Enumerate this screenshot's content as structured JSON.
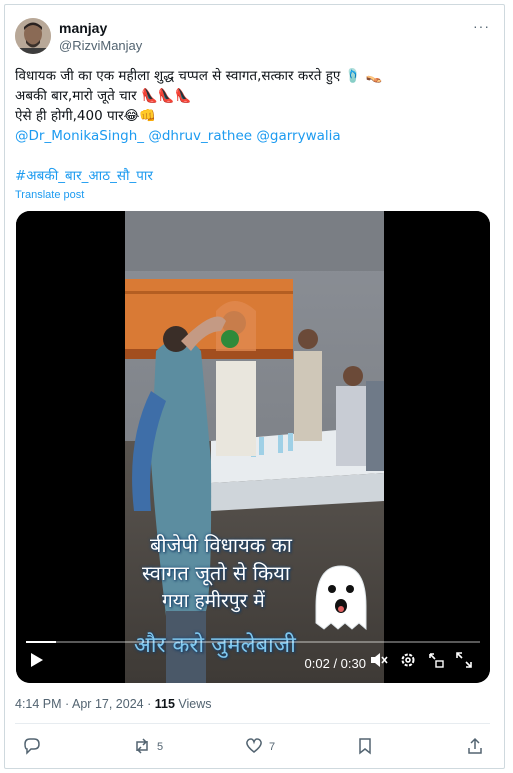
{
  "author": {
    "display_name": "manjay",
    "handle": "@RizviManjay",
    "more_label": "···"
  },
  "post": {
    "line1": "विधायक जी का एक महीला शुद्ध चप्पल से स्वागत,सत्कार करते हुए",
    "line2": "अबकी बार,मारो जूते चार",
    "line3": "ऐसे ही होगी,400 पार",
    "line1_emojis": "🩴 👡",
    "line2_emojis": "👠👠👠",
    "line3_emojis": "😂👊",
    "mentions": [
      "@Dr_MonikaSingh_",
      "@dhruv_rathee",
      "@garrywalia"
    ],
    "hashtag": "#अबकी_बार_आठ_सौ_पार",
    "translate": "Translate post"
  },
  "video": {
    "caption_line1": "बीजेपी विधायक का",
    "caption_line2": "स्वागत जूतो से किया",
    "caption_line3": "गया हमीरपुर में",
    "caption_line4": "और करो जुमलेबाजी",
    "ghost_emoji": "👻",
    "time": "0:02 / 0:30",
    "progress": 0.067
  },
  "meta": {
    "time": "4:14 PM",
    "separator": "·",
    "date": "Apr 17, 2024",
    "views_count": "115",
    "views_label": "Views"
  },
  "actions": {
    "reply_count": "",
    "repost_count": "5",
    "like_count": "7",
    "bookmark_count": ""
  },
  "colors": {
    "link": "#1d9bf0",
    "text": "#0f1419",
    "muted": "#536471"
  }
}
